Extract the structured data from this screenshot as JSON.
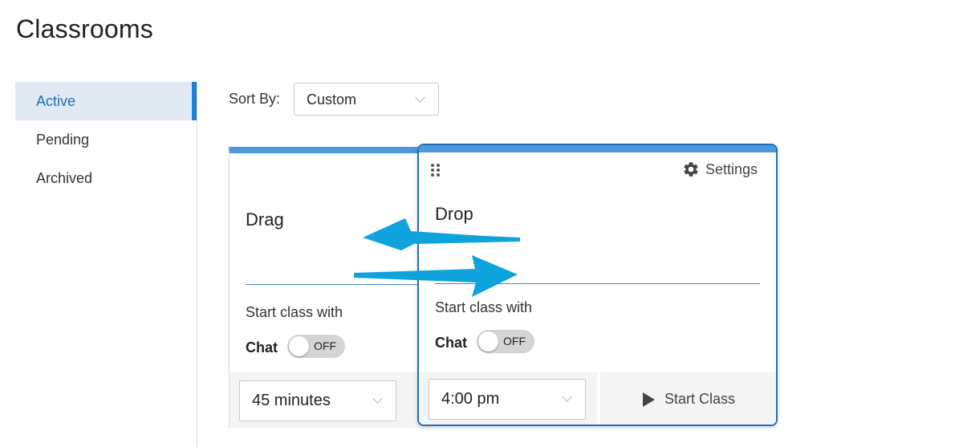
{
  "page": {
    "title": "Classrooms"
  },
  "sidebar": {
    "items": [
      {
        "label": "Active",
        "active": true
      },
      {
        "label": "Pending",
        "active": false
      },
      {
        "label": "Archived",
        "active": false
      }
    ]
  },
  "sort": {
    "label": "Sort By:",
    "value": "Custom"
  },
  "cards": {
    "drag": {
      "title": "Drag",
      "start_with": "Start class with",
      "chat_label": "Chat",
      "chat_state": "OFF",
      "duration": "45 minutes"
    },
    "drop": {
      "settings_label": "Settings",
      "title": "Drop",
      "start_with": "Start class with",
      "chat_label": "Chat",
      "chat_state": "OFF",
      "time": "4:00 pm",
      "start_button": "Start Class"
    }
  },
  "colors": {
    "accent": "#1e7fd6",
    "card_top_bar": "#4d98d8",
    "annotation_arrow": "#0ea3dc"
  },
  "icons": [
    "chevron-down-icon",
    "drag-handle-icon",
    "gear-icon",
    "play-icon",
    "swap-arrows-icon"
  ]
}
